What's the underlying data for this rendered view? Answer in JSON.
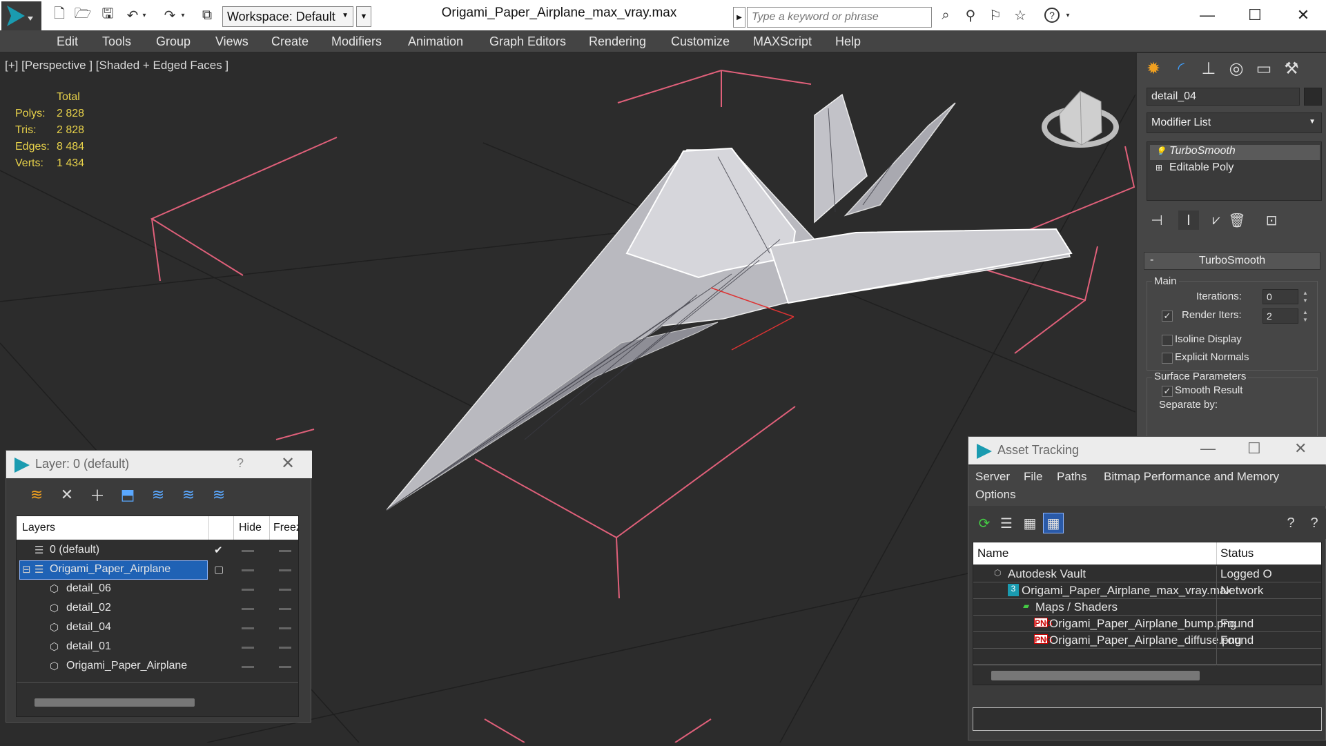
{
  "titlebar": {
    "workspace_label": "Workspace: Default",
    "document_title": "Origami_Paper_Airplane_max_vray.max",
    "search_placeholder": "Type a keyword or phrase",
    "help_label": "?"
  },
  "menubar": {
    "items": [
      "Edit",
      "Tools",
      "Group",
      "Views",
      "Create",
      "Modifiers",
      "Animation",
      "Graph Editors",
      "Rendering",
      "Customize",
      "MAXScript",
      "Help"
    ]
  },
  "viewport": {
    "label": "[+] [Perspective ] [Shaded + Edged Faces ]",
    "stats": {
      "header": "Total",
      "rows": [
        {
          "label": "Polys:",
          "value": "2 828"
        },
        {
          "label": "Tris:",
          "value": "2 828"
        },
        {
          "label": "Edges:",
          "value": "8 484"
        },
        {
          "label": "Verts:",
          "value": "1 434"
        }
      ]
    },
    "colors": {
      "background": "#2c2c2c",
      "grid": "#1f1f1f",
      "bracket": "#e0607a",
      "model": "#cfcfd4",
      "stats": "#e8d24a"
    }
  },
  "command_panel": {
    "object_name": "detail_04",
    "modifier_list": "Modifier List",
    "stack": [
      "TurboSmooth",
      "Editable Poly"
    ],
    "rollout": {
      "title": "TurboSmooth",
      "collapse": "-",
      "main_group": "Main",
      "iterations_label": "Iterations:",
      "iterations_value": "0",
      "render_iters_label": "Render Iters:",
      "render_iters_value": "2",
      "render_iters_checked": true,
      "isoline_display": "Isoline Display",
      "isoline_checked": false,
      "explicit_normals": "Explicit Normals",
      "explicit_checked": false,
      "surface_group": "Surface Parameters",
      "smooth_result": "Smooth Result",
      "smooth_checked": true,
      "separate_by": "Separate by:"
    }
  },
  "layer_dialog": {
    "title": "Layer: 0 (default)",
    "help": "?",
    "columns": [
      "Layers",
      "Hide",
      "Freez"
    ],
    "rows": [
      {
        "name": "0 (default)",
        "level": 1,
        "current": true,
        "selected": false
      },
      {
        "name": "Origami_Paper_Airplane",
        "level": 0,
        "current": false,
        "selected": true
      },
      {
        "name": "detail_06",
        "level": 2,
        "selected": false
      },
      {
        "name": "detail_02",
        "level": 2,
        "selected": false
      },
      {
        "name": "detail_04",
        "level": 2,
        "selected": false
      },
      {
        "name": "detail_01",
        "level": 2,
        "selected": false
      },
      {
        "name": "Origami_Paper_Airplane",
        "level": 2,
        "selected": false
      }
    ]
  },
  "asset_dialog": {
    "title": "Asset Tracking",
    "menu": [
      "Server",
      "File",
      "Paths",
      "Bitmap Performance and Memory",
      "Options"
    ],
    "columns": [
      "Name",
      "Status"
    ],
    "rows": [
      {
        "name": "Autodesk Vault",
        "status": "Logged O",
        "level": 1
      },
      {
        "name": "Origami_Paper_Airplane_max_vray.max",
        "status": "Network",
        "level": 2
      },
      {
        "name": "Maps / Shaders",
        "status": "",
        "level": 3
      },
      {
        "name": "Origami_Paper_Airplane_bump.png",
        "status": "Found",
        "level": 4
      },
      {
        "name": "Origami_Paper_Airplane_diffuse.png",
        "status": "Found",
        "level": 4
      }
    ]
  }
}
